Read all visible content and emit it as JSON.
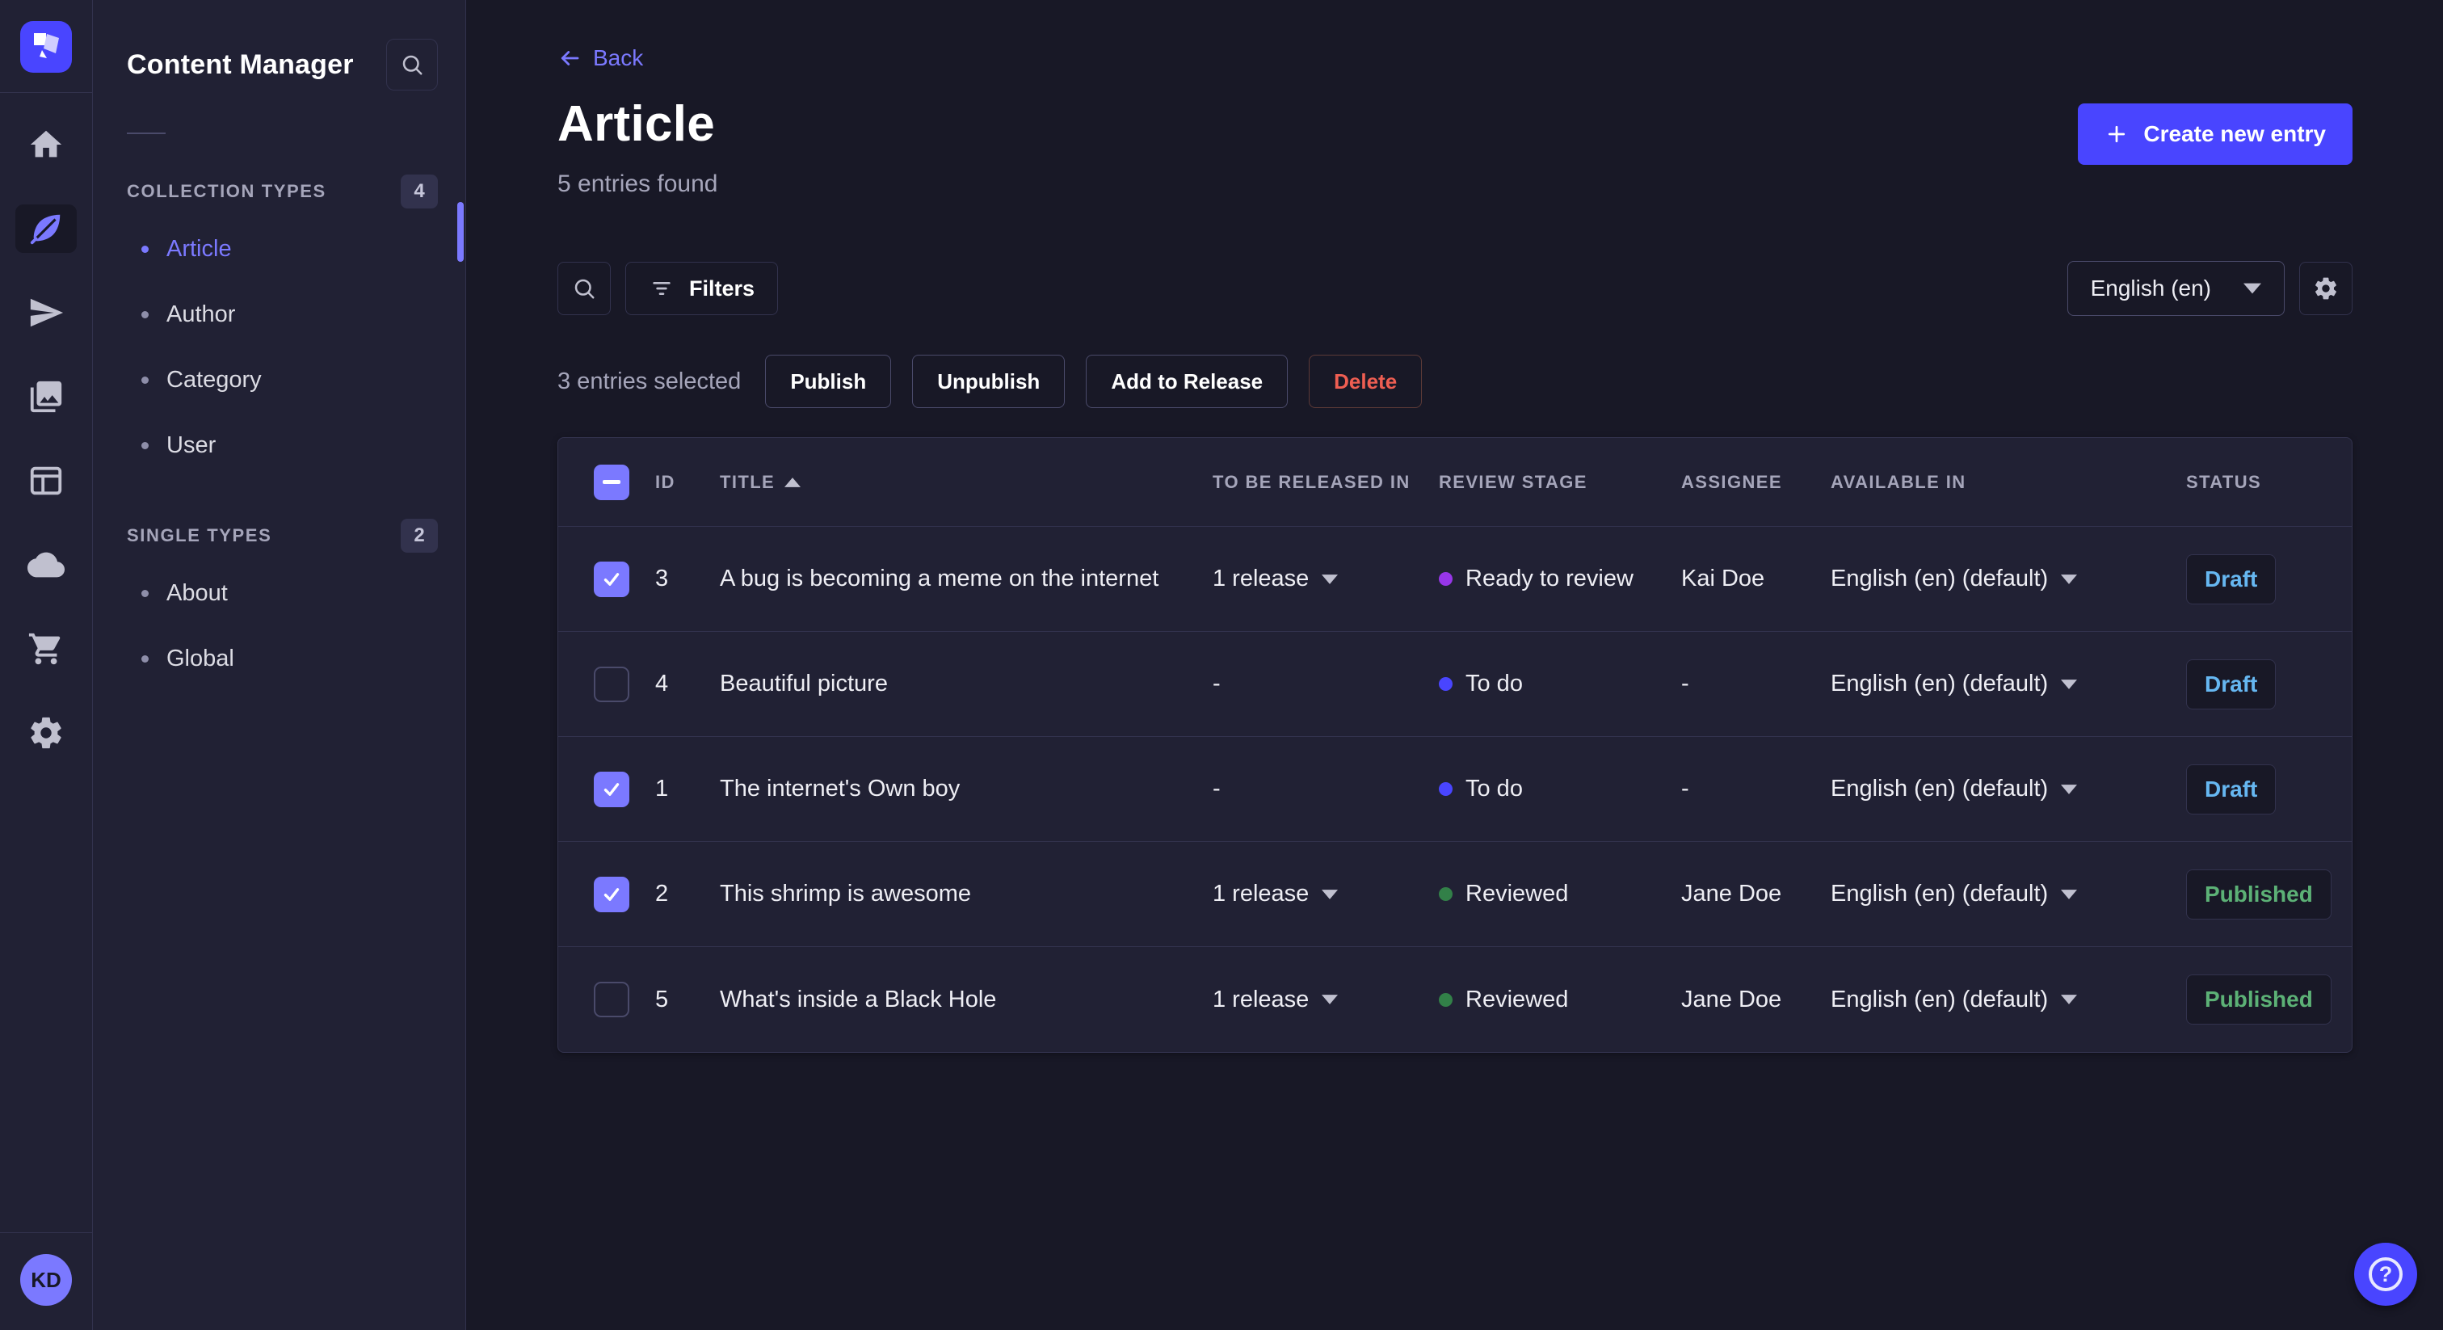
{
  "brand": {
    "primary_color": "#4945ff",
    "accent_color": "#7b79ff"
  },
  "main_nav": {
    "items": [
      {
        "name": "home"
      },
      {
        "name": "content-manager",
        "active": true
      },
      {
        "name": "deploy"
      },
      {
        "name": "media-library"
      },
      {
        "name": "content-type-builder"
      },
      {
        "name": "cloud"
      },
      {
        "name": "marketplace"
      },
      {
        "name": "settings"
      }
    ],
    "avatar_initials": "KD"
  },
  "subnav": {
    "title": "Content Manager",
    "sections": [
      {
        "label": "COLLECTION TYPES",
        "count": "4",
        "items": [
          {
            "label": "Article",
            "active": true
          },
          {
            "label": "Author"
          },
          {
            "label": "Category"
          },
          {
            "label": "User"
          }
        ]
      },
      {
        "label": "SINGLE TYPES",
        "count": "2",
        "items": [
          {
            "label": "About"
          },
          {
            "label": "Global"
          }
        ]
      }
    ]
  },
  "header": {
    "back_label": "Back",
    "title": "Article",
    "subtitle": "5 entries found",
    "create_button_label": "Create new entry"
  },
  "toolbar": {
    "filters_label": "Filters",
    "locale_value": "English (en)"
  },
  "selection": {
    "text": "3 entries selected",
    "publish_label": "Publish",
    "unpublish_label": "Unpublish",
    "add_to_release_label": "Add to Release",
    "delete_label": "Delete"
  },
  "table": {
    "columns": {
      "id": "ID",
      "title": "TITLE",
      "release": "TO BE RELEASED IN",
      "review_stage": "REVIEW STAGE",
      "assignee": "ASSIGNEE",
      "available_in": "AVAILABLE IN",
      "status": "STATUS"
    },
    "sorted_column": "TITLE",
    "sort_direction": "asc",
    "status_colors": {
      "Draft": "#66b7f1",
      "Published": "#5cb176"
    },
    "rows": [
      {
        "checked": true,
        "id": "3",
        "title": "A bug is becoming a meme on the internet",
        "release": "1 release",
        "stage": "Ready to review",
        "stage_color": "#9736e8",
        "assignee": "Kai Doe",
        "available": "English (en) (default)",
        "status": "Draft"
      },
      {
        "checked": false,
        "id": "4",
        "title": "Beautiful picture",
        "release": "-",
        "stage": "To do",
        "stage_color": "#4945ff",
        "assignee": "-",
        "available": "English (en) (default)",
        "status": "Draft"
      },
      {
        "checked": true,
        "id": "1",
        "title": "The internet's Own boy",
        "release": "-",
        "stage": "To do",
        "stage_color": "#4945ff",
        "assignee": "-",
        "available": "English (en) (default)",
        "status": "Draft"
      },
      {
        "checked": true,
        "id": "2",
        "title": "This shrimp is awesome",
        "release": "1 release",
        "stage": "Reviewed",
        "stage_color": "#328048",
        "assignee": "Jane Doe",
        "available": "English (en) (default)",
        "status": "Published"
      },
      {
        "checked": false,
        "id": "5",
        "title": "What's inside a Black Hole",
        "release": "1 release",
        "stage": "Reviewed",
        "stage_color": "#328048",
        "assignee": "Jane Doe",
        "available": "English (en) (default)",
        "status": "Published"
      }
    ]
  },
  "help": {
    "label": "?"
  }
}
